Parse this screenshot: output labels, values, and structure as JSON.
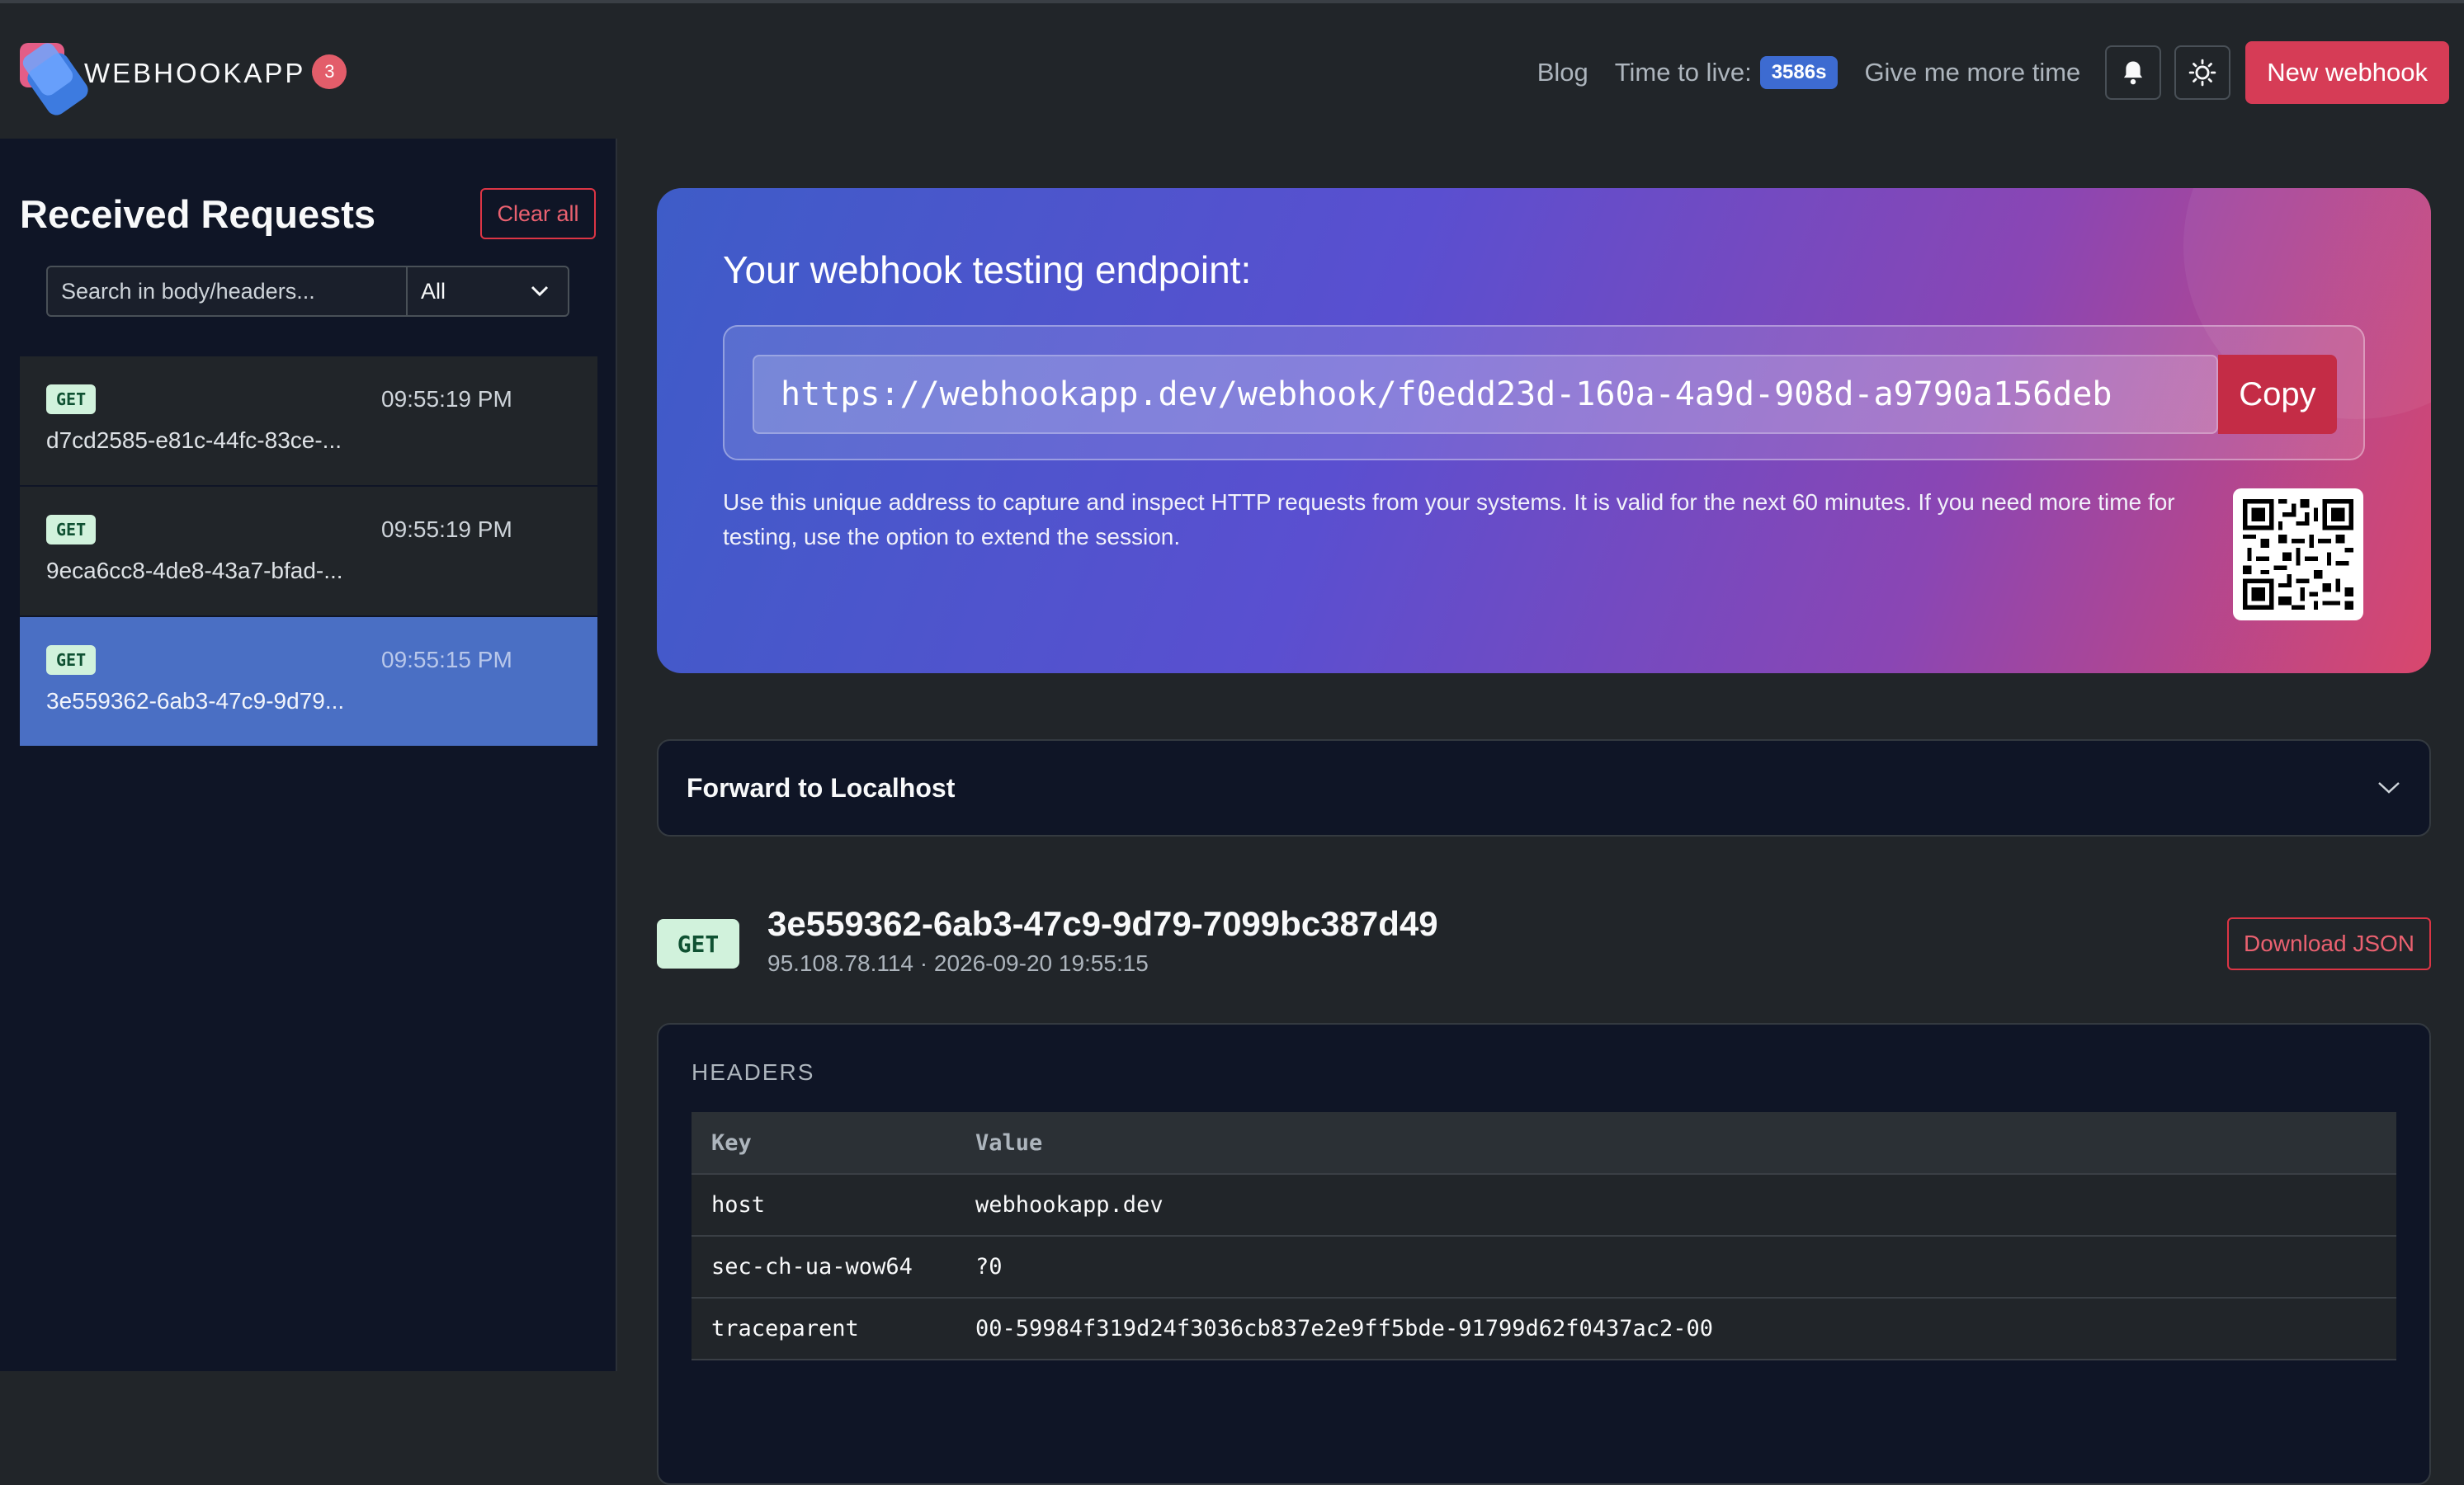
{
  "header": {
    "brand": "WEBHOOKAPP",
    "brand_count": "3",
    "nav": {
      "blog": "Blog",
      "ttl_label": "Time to live:",
      "ttl_value": "3586s",
      "more_time": "Give me more time",
      "new_webhook": "New webhook"
    },
    "icons": [
      "bell-icon",
      "sun-icon"
    ]
  },
  "sidebar": {
    "title": "Received Requests",
    "clear_all": "Clear all",
    "search_placeholder": "Search in body/headers...",
    "filter_value": "All",
    "requests": [
      {
        "method": "GET",
        "time": "09:55:19 PM",
        "id": "d7cd2585-e81c-44fc-83ce-..."
      },
      {
        "method": "GET",
        "time": "09:55:19 PM",
        "id": "9eca6cc8-4de8-43a7-bfad-..."
      },
      {
        "method": "GET",
        "time": "09:55:15 PM",
        "id": "3e559362-6ab3-47c9-9d79..."
      }
    ]
  },
  "hero": {
    "title": "Your webhook testing endpoint:",
    "endpoint": "https://webhookapp.dev/webhook/f0edd23d-160a-4a9d-908d-a9790a156deb",
    "copy": "Copy",
    "description": "Use this unique address to capture and inspect HTTP requests from your systems. It is valid for the next 60 minutes. If you need more time for testing, use the option to extend the session."
  },
  "forward": {
    "title": "Forward to Localhost"
  },
  "detail": {
    "method": "GET",
    "id": "3e559362-6ab3-47c9-9d79-7099bc387d49",
    "meta": "95.108.78.114 · 2026-09-20 19:55:15",
    "download": "Download JSON"
  },
  "headers": {
    "title": "HEADERS",
    "columns": [
      "Key",
      "Value"
    ],
    "rows": [
      {
        "key": "host",
        "value": "webhookapp.dev"
      },
      {
        "key": "sec-ch-ua-wow64",
        "value": "?0"
      },
      {
        "key": "traceparent",
        "value": "00-59984f319d24f3036cb837e2e9ff5bde-91799d62f0437ac2-00"
      }
    ]
  },
  "colors": {
    "accent": "#d63c56",
    "selected": "#4a6fc4",
    "ttl_badge": "#3d6bd1",
    "method_badge": "#d1f2dc"
  }
}
